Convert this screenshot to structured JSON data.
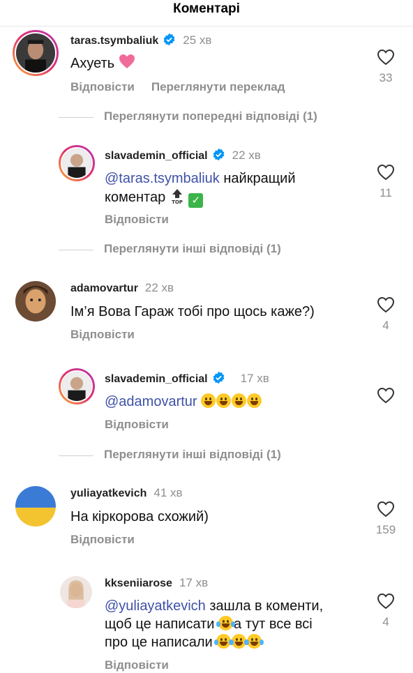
{
  "header": {
    "title": "Коментарі"
  },
  "comments": [
    {
      "username": "taras.tsymbaliuk",
      "verified": true,
      "time": "25 хв",
      "text_before": "Ахуеть",
      "likes": "33",
      "reply_label": "Відповісти",
      "translate_label": "Переглянути переклад",
      "emoji": "heart"
    },
    {
      "username": "slavademin_official",
      "verified": true,
      "time": "22 хв",
      "mention": "@taras.tsymbaliuk",
      "text_line1": " найкращий",
      "text_line2": "коментар",
      "likes": "11",
      "reply_label": "Відповісти"
    },
    {
      "username": "adamovartur",
      "verified": false,
      "time": "22 хв",
      "text": "Ім’я Вова Гараж тобі про щось каже?)",
      "likes": "4",
      "reply_label": "Відповісти"
    },
    {
      "username": "slavademin_official",
      "verified": true,
      "time": "17 хв",
      "mention": "@adamovartur",
      "likes": "",
      "reply_label": "Відповісти"
    },
    {
      "username": "yuliayatkevich",
      "verified": false,
      "time": "41 хв",
      "text": "На кіркорова схожий)",
      "likes": "159",
      "reply_label": "Відповісти"
    },
    {
      "username": "kkseniiarose",
      "verified": false,
      "time": "17 хв",
      "mention": "@yuliayatkevich",
      "text_line1": " зашла в коменти,",
      "text_line2": "щоб це написати",
      "text_line2b": "а тут все всі",
      "text_line3": "про це написали",
      "likes": "4",
      "reply_label": "Відповісти"
    }
  ],
  "threads": [
    {
      "label": "Переглянути попередні відповіді (1)"
    },
    {
      "label": "Переглянути інші відповіді (1)"
    },
    {
      "label": "Переглянути інші відповіді (1)"
    }
  ],
  "colors": {
    "mention": "#3f51a8",
    "muted": "#8e8e8e",
    "verified": "#0095f6"
  }
}
